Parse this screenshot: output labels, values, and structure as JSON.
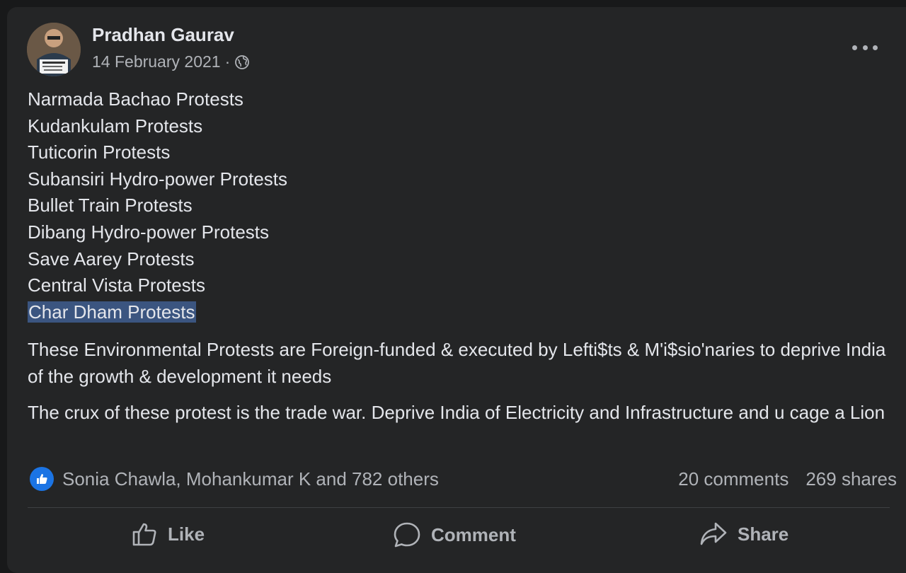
{
  "post": {
    "author": "Pradhan Gaurav",
    "date": "14 February 2021",
    "separator": "·",
    "audience_icon": "globe-icon",
    "avatar_text": "WARNING I NEVER pay Money to my barber / NEVER ask for MONEY",
    "list_items": [
      "Narmada Bachao Protests",
      "Kudankulam Protests",
      "Tuticorin Protests",
      "Subansiri Hydro-power Protests",
      "Bullet Train Protests",
      "Dibang Hydro-power Protests",
      "Save Aarey Protests",
      "Central Vista Protests",
      "Char Dham Protests"
    ],
    "paragraph1": "These Environmental Protests are Foreign-funded & executed by Lefti$ts & M'i$sio'naries to deprive India of the growth & development it needs",
    "paragraph2": "The crux of these protest is the trade war. Deprive India of Electricity and Infrastructure and u cage a Lion"
  },
  "stats": {
    "reactions_text": "Sonia Chawla, Mohankumar K and 782 others",
    "comments": "20 comments",
    "shares": "269 shares"
  },
  "actions": {
    "like": "Like",
    "comment": "Comment",
    "share": "Share"
  },
  "colors": {
    "background": "#18191a",
    "card": "#242526",
    "text_primary": "#e4e6eb",
    "text_secondary": "#b0b3b8",
    "highlight": "#3b5580",
    "like_blue": "#1b74e4"
  }
}
